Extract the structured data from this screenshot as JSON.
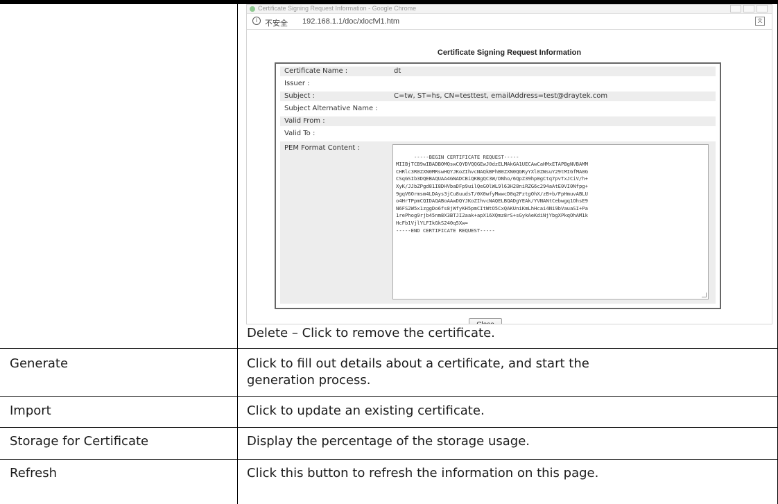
{
  "browser": {
    "window_title": "Certificate Signing Request Information - Google Chrome",
    "security_label": "不安全",
    "url": "192.168.1.1/doc/xlocfvl1.htm"
  },
  "csr": {
    "heading": "Certificate Signing Request Information",
    "rows": [
      {
        "label": "Certificate Name :",
        "value": "dt"
      },
      {
        "label": "Issuer :",
        "value": ""
      },
      {
        "label": "Subject :",
        "value": "C=tw, ST=hs, CN=testtest, emailAddress=test@draytek.com"
      },
      {
        "label": "Subject Alternative Name :",
        "value": ""
      },
      {
        "label": "Valid From :",
        "value": ""
      },
      {
        "label": "Valid To :",
        "value": ""
      }
    ],
    "pem_label": "PEM Format Content :",
    "pem_content": "-----BEGIN CERTIFICATE REQUEST-----\nMIIBjTCB9wIBADBOMQswCQYDVQQGEwJ0dzELMAkGA1UECAwCaHMxETAPBgNVBAMM\nCHRlc3R0ZXN0MRswHQYJKoZIhvcNAQkBFhB0ZXN0QGRyYXl0ZWsuY29tMIGfMA0G\nCSqGSIb3DQEBAQUAA4GNADCBiQKBgQC3W/DNho/6QpZ39hp0gCtq7pvTxJCiV/h+\nXyK/JJbZPgd81I8DHVbaDFp9uilQeGOlWL9l63H28niRZG6c294aAtE0VI0Nfpg+\n9gqV6Ormsm4LDAys3jCu8uudsT/0X0wfyMwwcD0q2FztgOhX/zB+b/FpHmuvABLU\no4HrTPpmCQIDAQABoAAwDQYJKoZIhvcNAQELBQADgYEAk/YVNANtCebwgq1OhsE9\nN6FS2W5x1zggDo6fs8jWfyKH5pmCItWtO5CxQAKUniKmLhHcai4Ni9bVauaSI+Pa\n1rePhog9rjb45nm8X3BTJI2aak+apX16XQmz8rS+sGykAeKdiNjYbgXPkqOhAM1k\nHcFb1VjlYLFIkGkS240q5Xw=\n-----END CERTIFICATE REQUEST-----",
    "close_label": "Close"
  },
  "doc": {
    "delete_text": "Delete – Click to remove the certificate.",
    "rows": [
      {
        "term": "Generate",
        "desc_line1": "Click to fill out details about a certificate, and start the",
        "desc_line2": "generation process."
      },
      {
        "term": "Import",
        "desc_line1": "Click to update an existing certificate.",
        "desc_line2": ""
      },
      {
        "term": "Storage for Certificate",
        "desc_line1": "Display the percentage of the storage usage.",
        "desc_line2": ""
      },
      {
        "term": "Refresh",
        "desc_line1": "Click this button to refresh the information on this page.",
        "desc_line2": ""
      }
    ]
  }
}
